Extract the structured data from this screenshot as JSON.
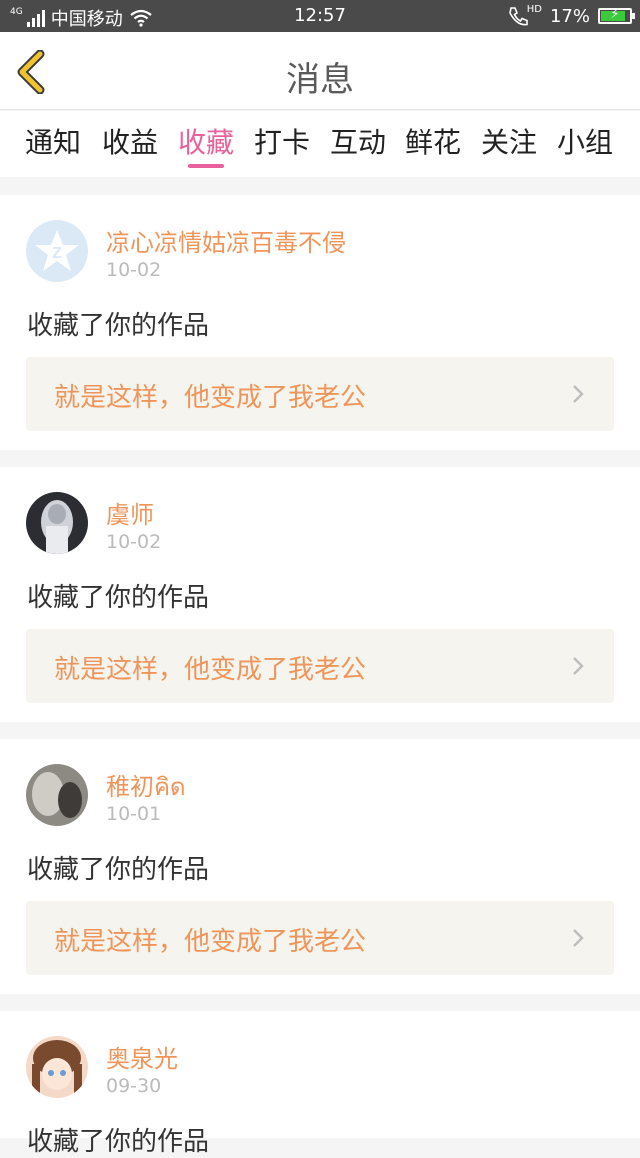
{
  "status_bar": {
    "network": "4G",
    "carrier": "中国移动",
    "time": "12:57",
    "hd": "HD",
    "battery": "17%",
    "battery_level": 0.17
  },
  "header": {
    "title": "消息",
    "back_icon": "chevron-left-icon"
  },
  "tabs": [
    {
      "label": "通知"
    },
    {
      "label": "收益"
    },
    {
      "label": "收藏",
      "active": true
    },
    {
      "label": "打卡"
    },
    {
      "label": "互动"
    },
    {
      "label": "鲜花"
    },
    {
      "label": "关注"
    },
    {
      "label": "小组"
    }
  ],
  "colors": {
    "accent": "#e8619b",
    "username": "#f0955a",
    "link_bg": "#f5f4ef"
  },
  "messages": [
    {
      "username": "凉心凉情姑凉百毒不侵",
      "date": "10-02",
      "action": "收藏了你的作品",
      "work_title": "就是这样，他变成了我老公"
    },
    {
      "username": "虞师",
      "date": "10-02",
      "action": "收藏了你的作品",
      "work_title": "就是这样，他变成了我老公"
    },
    {
      "username": "稚初คิด",
      "date": "10-01",
      "action": "收藏了你的作品",
      "work_title": "就是这样，他变成了我老公"
    },
    {
      "username": "奥泉光",
      "date": "09-30",
      "action": "收藏了你的作品",
      "work_title": ""
    }
  ]
}
